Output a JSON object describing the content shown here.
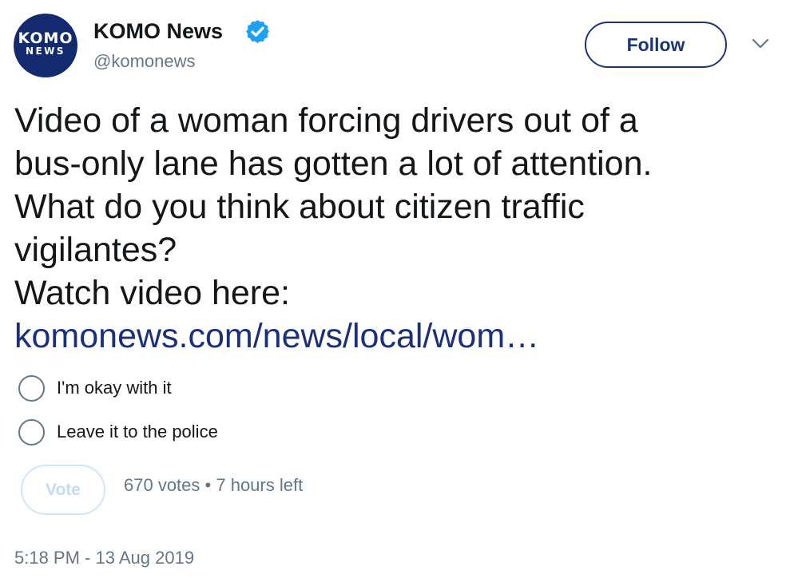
{
  "account": {
    "display_name": "KOMO News",
    "handle": "@komonews",
    "verified": true,
    "avatar_text_line1": "KOMO",
    "avatar_text_line2": "NEWS",
    "avatar_color": "#142a6e"
  },
  "header": {
    "follow_label": "Follow",
    "menu_icon": "chevron-down-icon"
  },
  "tweet": {
    "text_lines": [
      "Video of a woman forcing drivers out of a",
      "bus-only lane has gotten a lot of attention.",
      "What do you think about citizen traffic",
      "vigilantes?",
      "Watch video here:"
    ],
    "link_text": "komonews.com/news/local/wom…"
  },
  "poll": {
    "options": [
      {
        "label": "I'm okay with it"
      },
      {
        "label": "Leave it to the police"
      }
    ],
    "vote_label": "Vote",
    "votes": "670 votes",
    "separator": "•",
    "time_left": "7 hours left"
  },
  "timestamp": "5:18 PM - 13 Aug 2019",
  "colors": {
    "brand_navy": "#1c3577",
    "verified_blue": "#1da1f2",
    "link": "#1b2f7a",
    "muted_text": "#657786",
    "vote_disabled": "#c3dcf4"
  }
}
